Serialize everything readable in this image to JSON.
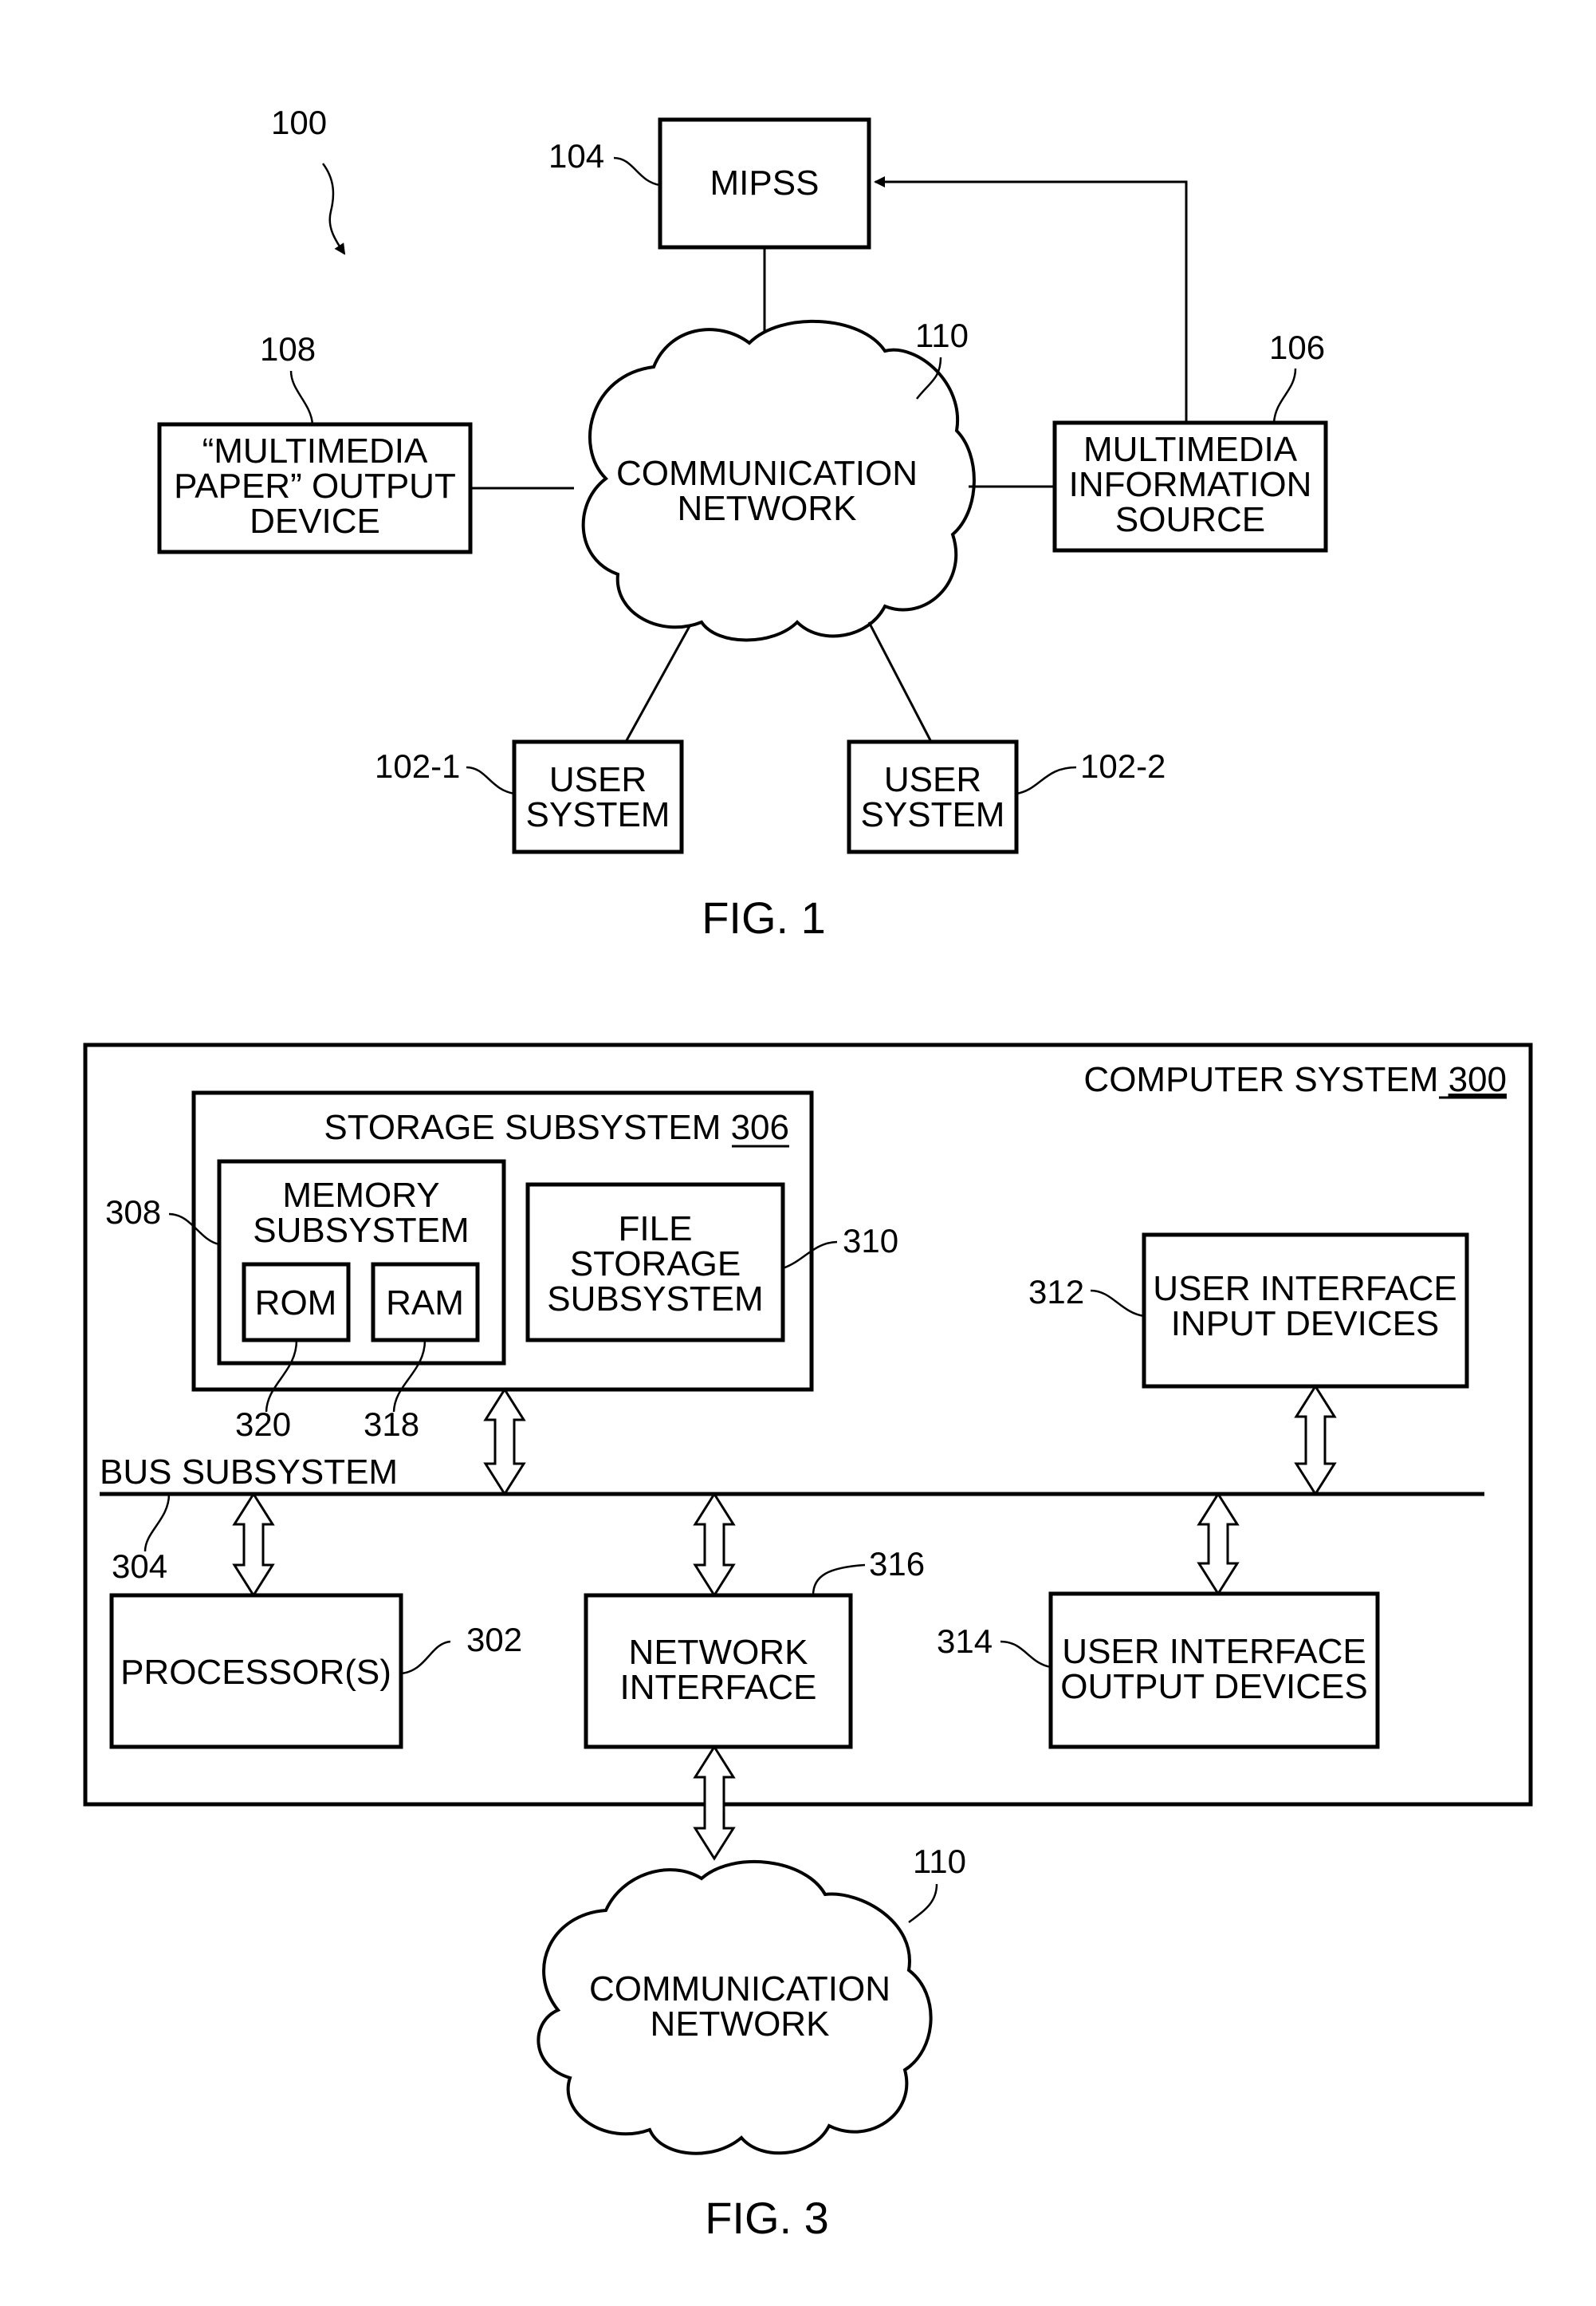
{
  "fig1": {
    "caption": "FIG. 1",
    "system_ref": "100",
    "mipss": {
      "ref": "104",
      "lines": [
        "MIPSS"
      ]
    },
    "network": {
      "ref": "110",
      "lines": [
        "COMMUNICATION",
        "NETWORK"
      ]
    },
    "output_device": {
      "ref": "108",
      "lines": [
        "“MULTIMEDIA",
        "PAPER” OUTPUT",
        "DEVICE"
      ]
    },
    "info_source": {
      "ref": "106",
      "lines": [
        "MULTIMEDIA",
        "INFORMATION",
        "SOURCE"
      ]
    },
    "user_system_1": {
      "ref": "102-1",
      "lines": [
        "USER",
        "SYSTEM"
      ]
    },
    "user_system_2": {
      "ref": "102-2",
      "lines": [
        "USER",
        "SYSTEM"
      ]
    }
  },
  "fig3": {
    "caption": "FIG. 3",
    "computer_system": {
      "label": "COMPUTER SYSTEM ",
      "ref": "300"
    },
    "storage_subsystem": {
      "label": "STORAGE SUBSYSTEM ",
      "ref": "306"
    },
    "memory_subsystem": {
      "ref": "308",
      "lines": [
        "MEMORY",
        "SUBSYSTEM"
      ]
    },
    "rom": {
      "ref": "320",
      "label": "ROM"
    },
    "ram": {
      "ref": "318",
      "label": "RAM"
    },
    "file_storage": {
      "ref": "310",
      "lines": [
        "FILE",
        "STORAGE",
        "SUBSYSTEM"
      ]
    },
    "ui_input": {
      "ref": "312",
      "lines": [
        "USER INTERFACE",
        "INPUT DEVICES"
      ]
    },
    "bus": {
      "label": "BUS SUBSYSTEM",
      "ref": "304"
    },
    "processor": {
      "ref": "302",
      "lines": [
        "PROCESSOR(S)"
      ]
    },
    "network_interface": {
      "ref": "316",
      "lines": [
        "NETWORK",
        "INTERFACE"
      ]
    },
    "ui_output": {
      "ref": "314",
      "lines": [
        "USER INTERFACE",
        "OUTPUT DEVICES"
      ]
    },
    "network": {
      "ref": "110",
      "lines": [
        "COMMUNICATION",
        "NETWORK"
      ]
    }
  }
}
